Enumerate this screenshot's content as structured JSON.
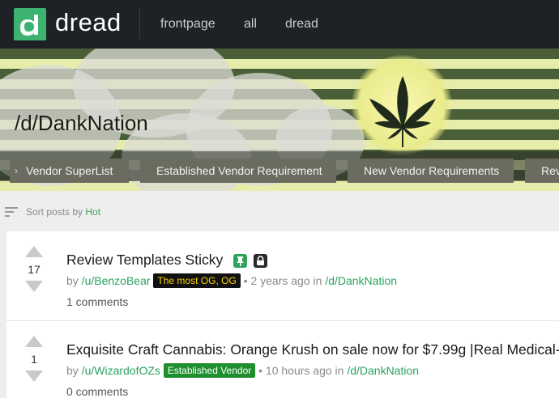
{
  "brand": {
    "name": "dread",
    "logo_letter": "d",
    "accent": "#3cb371"
  },
  "nav": {
    "links": [
      "frontpage",
      "all",
      "dread"
    ]
  },
  "subdread": {
    "title": "/d/DankNation",
    "tabs": [
      "Vendor SuperList",
      "Established Vendor Requirement",
      "New Vendor Requirements",
      "Rev"
    ]
  },
  "sort": {
    "prefix": "Sort posts by",
    "value": "Hot"
  },
  "posts": [
    {
      "votes": "17",
      "title": "Review Templates Sticky",
      "by": "by",
      "author": "/u/BenzoBear",
      "flair": "The most OG, OG",
      "age": "• 2 years ago in",
      "sub": "/d/DankNation",
      "comments": "1 comments",
      "icons": [
        "pin-icon",
        "lock-icon"
      ]
    },
    {
      "votes": "1",
      "title": "Exquisite Craft Cannabis: Orange Krush on sale now for $7.99g |Real Medical-",
      "by": "by",
      "author": "/u/WizardofOZs",
      "flair": "Established Vendor",
      "age": "• 10 hours ago in",
      "sub": "/d/DankNation",
      "comments": "0 comments"
    }
  ]
}
